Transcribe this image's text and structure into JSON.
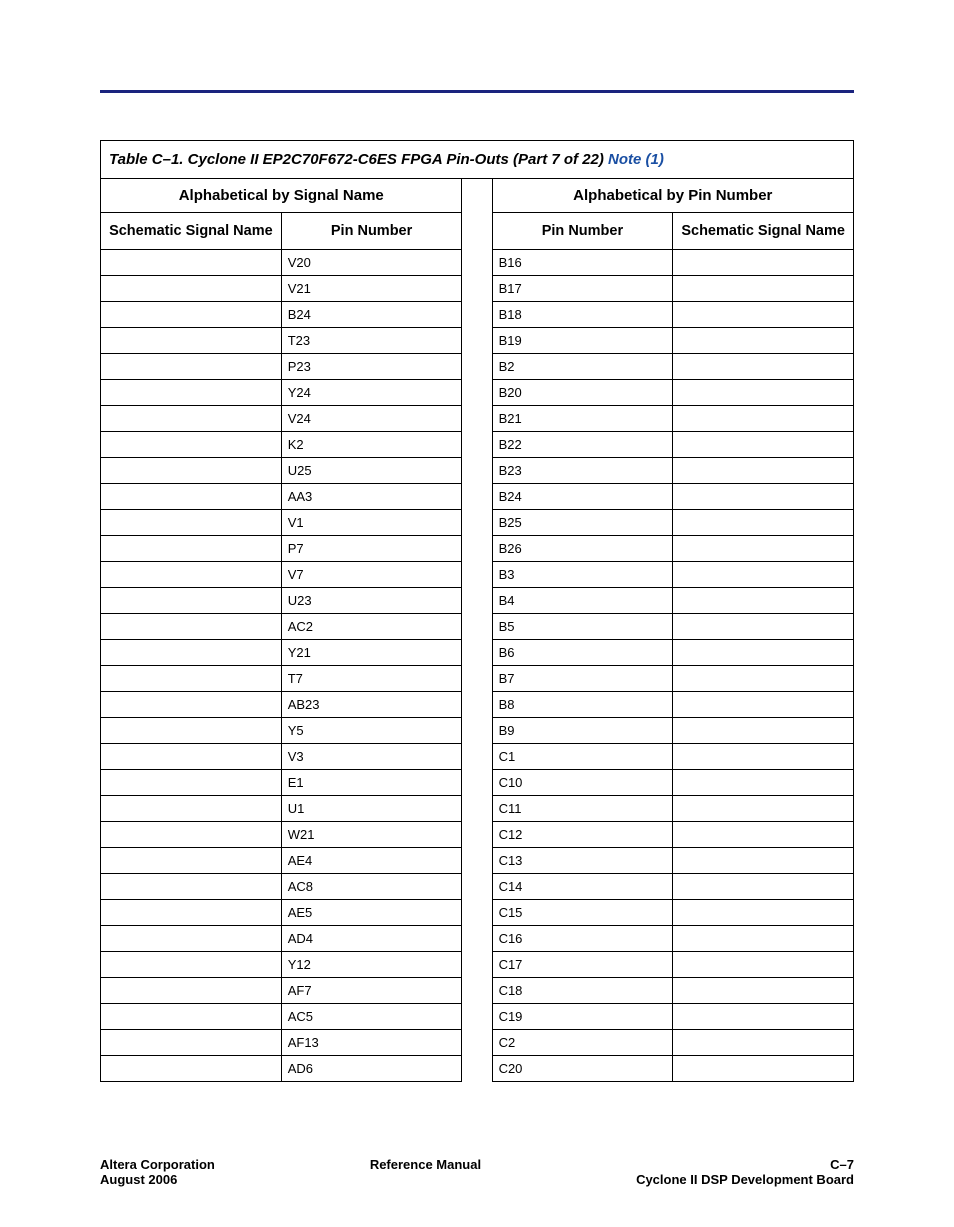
{
  "caption": {
    "main": "Table C–1. Cyclone II EP2C70F672-C6ES FPGA Pin-Outs  (Part 7 of 22) ",
    "note": "Note (1)"
  },
  "group_headers": {
    "left": "Alphabetical by Signal Name",
    "right": "Alphabetical by Pin Number"
  },
  "col_headers": {
    "l1": "Schematic Signal Name",
    "l2": "Pin Number",
    "r1": "Pin Number",
    "r2": "Schematic Signal Name"
  },
  "rows": [
    {
      "l1": "",
      "l2": "V20",
      "r1": "B16",
      "r2": ""
    },
    {
      "l1": "",
      "l2": "V21",
      "r1": "B17",
      "r2": ""
    },
    {
      "l1": "",
      "l2": "B24",
      "r1": "B18",
      "r2": ""
    },
    {
      "l1": "",
      "l2": "T23",
      "r1": "B19",
      "r2": ""
    },
    {
      "l1": "",
      "l2": "P23",
      "r1": "B2",
      "r2": ""
    },
    {
      "l1": "",
      "l2": "Y24",
      "r1": "B20",
      "r2": ""
    },
    {
      "l1": "",
      "l2": "V24",
      "r1": "B21",
      "r2": ""
    },
    {
      "l1": "",
      "l2": "K2",
      "r1": "B22",
      "r2": ""
    },
    {
      "l1": "",
      "l2": "U25",
      "r1": "B23",
      "r2": ""
    },
    {
      "l1": "",
      "l2": "AA3",
      "r1": "B24",
      "r2": ""
    },
    {
      "l1": "",
      "l2": "V1",
      "r1": "B25",
      "r2": ""
    },
    {
      "l1": "",
      "l2": "P7",
      "r1": "B26",
      "r2": ""
    },
    {
      "l1": "",
      "l2": "V7",
      "r1": "B3",
      "r2": ""
    },
    {
      "l1": "",
      "l2": "U23",
      "r1": "B4",
      "r2": ""
    },
    {
      "l1": "",
      "l2": "AC2",
      "r1": "B5",
      "r2": ""
    },
    {
      "l1": "",
      "l2": "Y21",
      "r1": "B6",
      "r2": ""
    },
    {
      "l1": "",
      "l2": "T7",
      "r1": "B7",
      "r2": ""
    },
    {
      "l1": "",
      "l2": "AB23",
      "r1": "B8",
      "r2": ""
    },
    {
      "l1": "",
      "l2": "Y5",
      "r1": "B9",
      "r2": ""
    },
    {
      "l1": "",
      "l2": "V3",
      "r1": "C1",
      "r2": ""
    },
    {
      "l1": "",
      "l2": "E1",
      "r1": "C10",
      "r2": ""
    },
    {
      "l1": "",
      "l2": "U1",
      "r1": "C11",
      "r2": ""
    },
    {
      "l1": "",
      "l2": "W21",
      "r1": "C12",
      "r2": ""
    },
    {
      "l1": "",
      "l2": "AE4",
      "r1": "C13",
      "r2": ""
    },
    {
      "l1": "",
      "l2": "AC8",
      "r1": "C14",
      "r2": ""
    },
    {
      "l1": "",
      "l2": "AE5",
      "r1": "C15",
      "r2": ""
    },
    {
      "l1": "",
      "l2": "AD4",
      "r1": "C16",
      "r2": ""
    },
    {
      "l1": "",
      "l2": "Y12",
      "r1": "C17",
      "r2": ""
    },
    {
      "l1": "",
      "l2": "AF7",
      "r1": "C18",
      "r2": ""
    },
    {
      "l1": "",
      "l2": "AC5",
      "r1": "C19",
      "r2": ""
    },
    {
      "l1": "",
      "l2": "AF13",
      "r1": "C2",
      "r2": ""
    },
    {
      "l1": "",
      "l2": "AD6",
      "r1": "C20",
      "r2": ""
    }
  ],
  "footer": {
    "left_line1": "Altera Corporation",
    "left_line2": "August 2006",
    "center": "Reference Manual",
    "right_line1": "C–7",
    "right_line2": "Cyclone II DSP Development Board"
  }
}
